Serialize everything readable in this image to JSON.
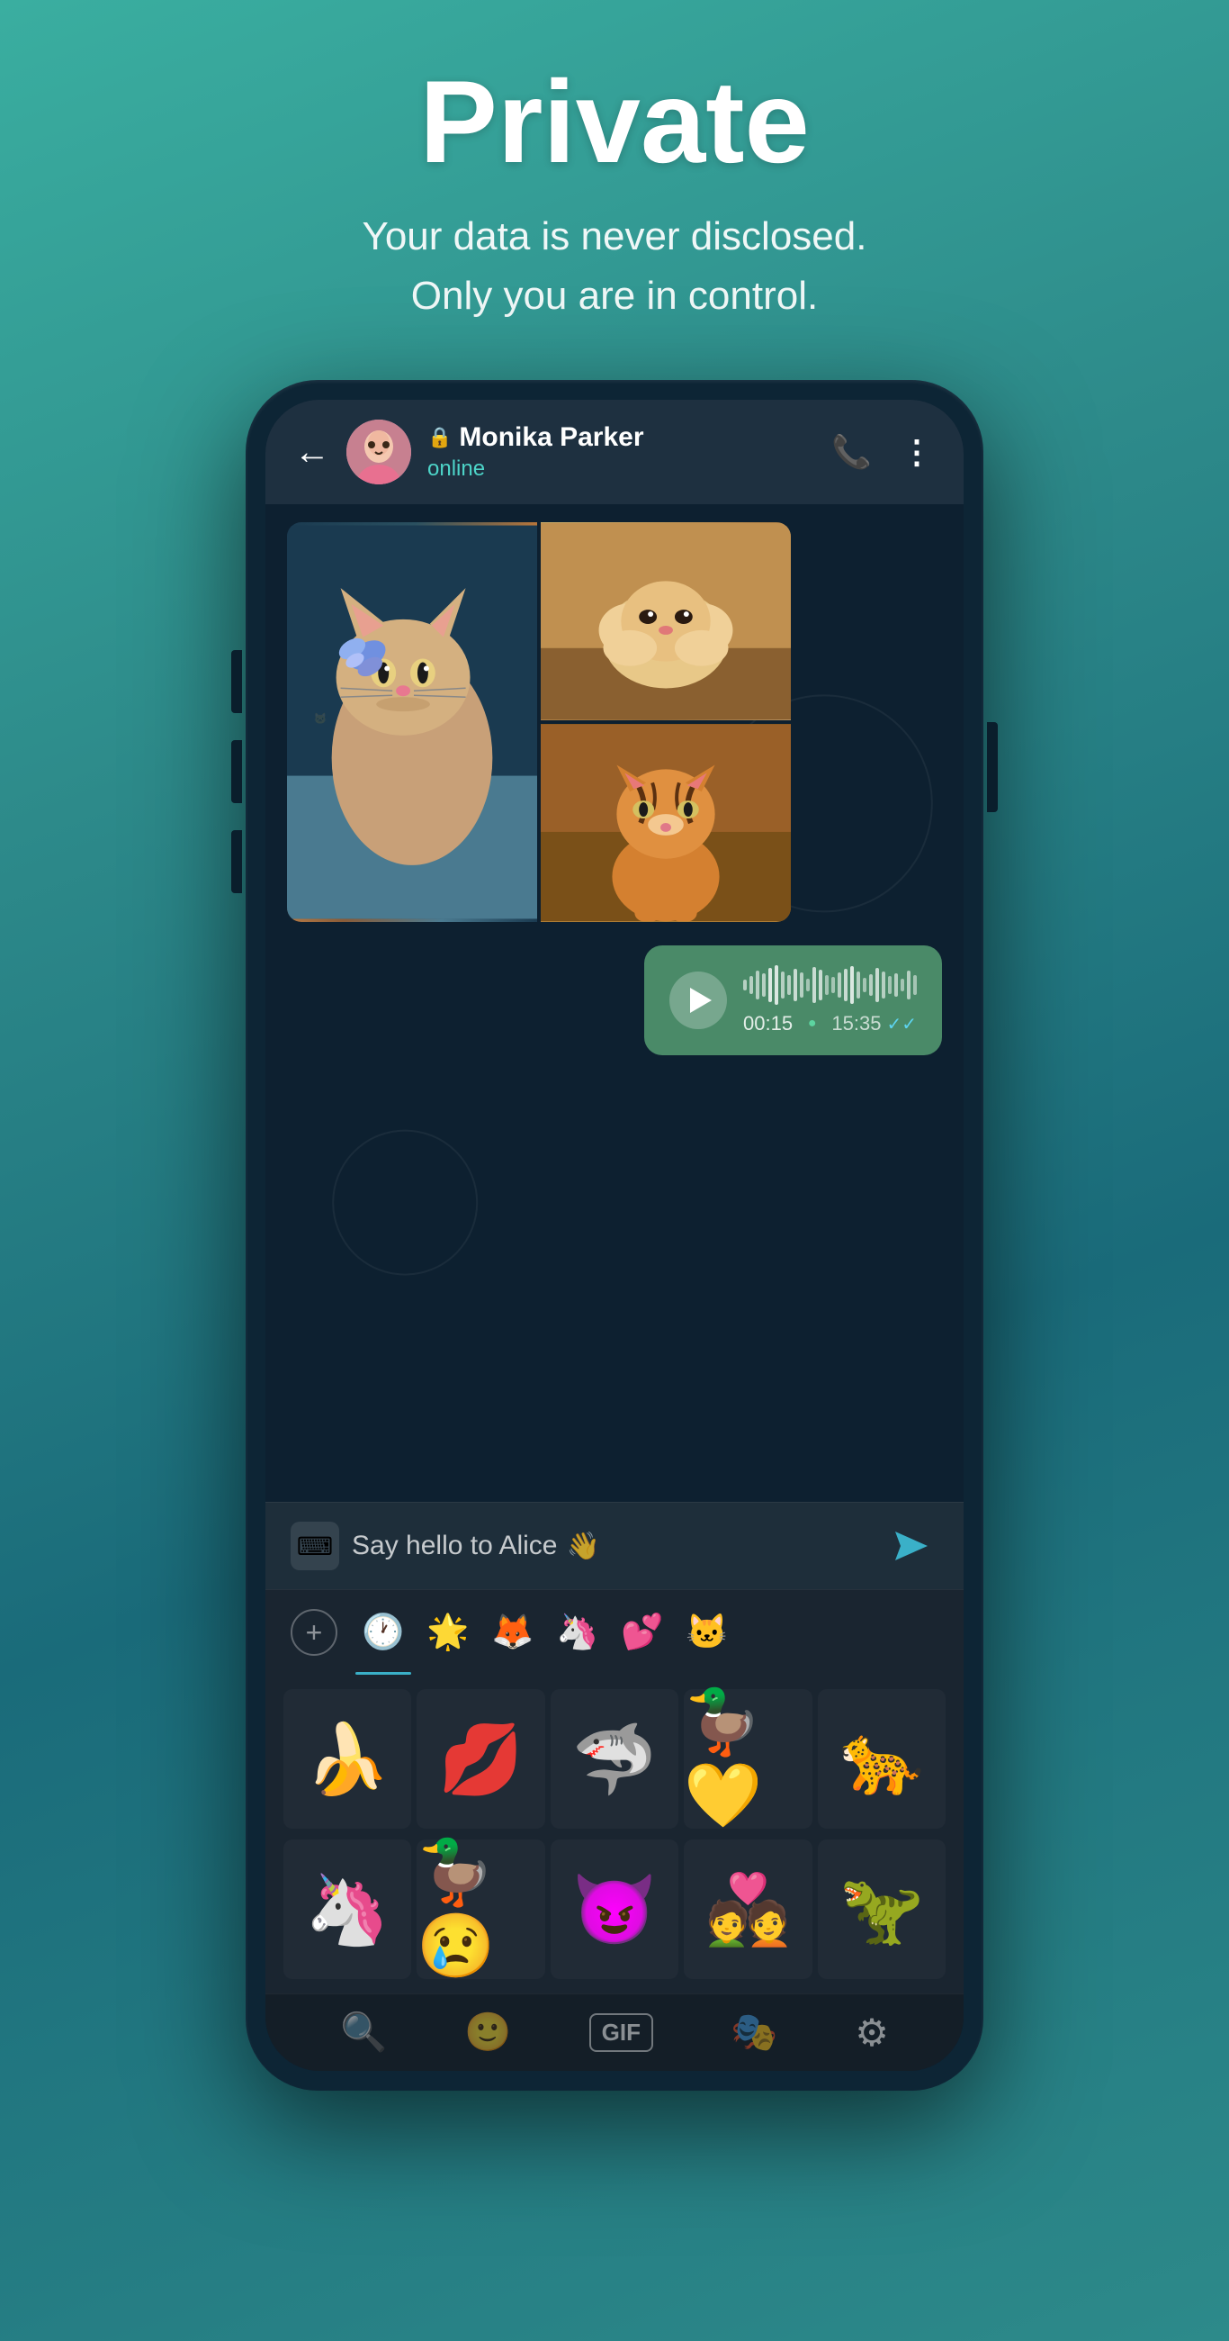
{
  "page": {
    "background": "#2d8a8a"
  },
  "header": {
    "title": "Private",
    "subtitle_line1": "Your data is never disclosed.",
    "subtitle_line2": "Only you are in control."
  },
  "chat": {
    "contact": {
      "name": "Monika Parker",
      "status": "online",
      "lock_icon": "🔒"
    },
    "back_label": "←",
    "call_icon": "📞",
    "more_icon": "⋮"
  },
  "voice_message": {
    "duration": "00:15",
    "timestamp": "15:35",
    "checks": "✓✓"
  },
  "input": {
    "placeholder": "Say hello to Alice",
    "wave_emoji": "👋",
    "keyboard_icon": "⌨",
    "send_icon": "➤"
  },
  "sticker_tabs": {
    "recent_icon": "🕐",
    "stickers": [
      "🌟",
      "🦊",
      "🦄",
      "💕",
      "🐱"
    ]
  },
  "sticker_grid_row1": [
    "🍌😎",
    "💋",
    "🦈",
    "💛🦆",
    "🐆"
  ],
  "sticker_grid_row2": [
    "🦄💗",
    "🦆😢",
    "😈",
    "💑",
    "🦖"
  ],
  "bottom_bar": {
    "search_icon": "🔍",
    "emoji_icon": "🙂",
    "gif_label": "GIF",
    "sticker_icon": "🎭",
    "settings_icon": "⚙"
  }
}
